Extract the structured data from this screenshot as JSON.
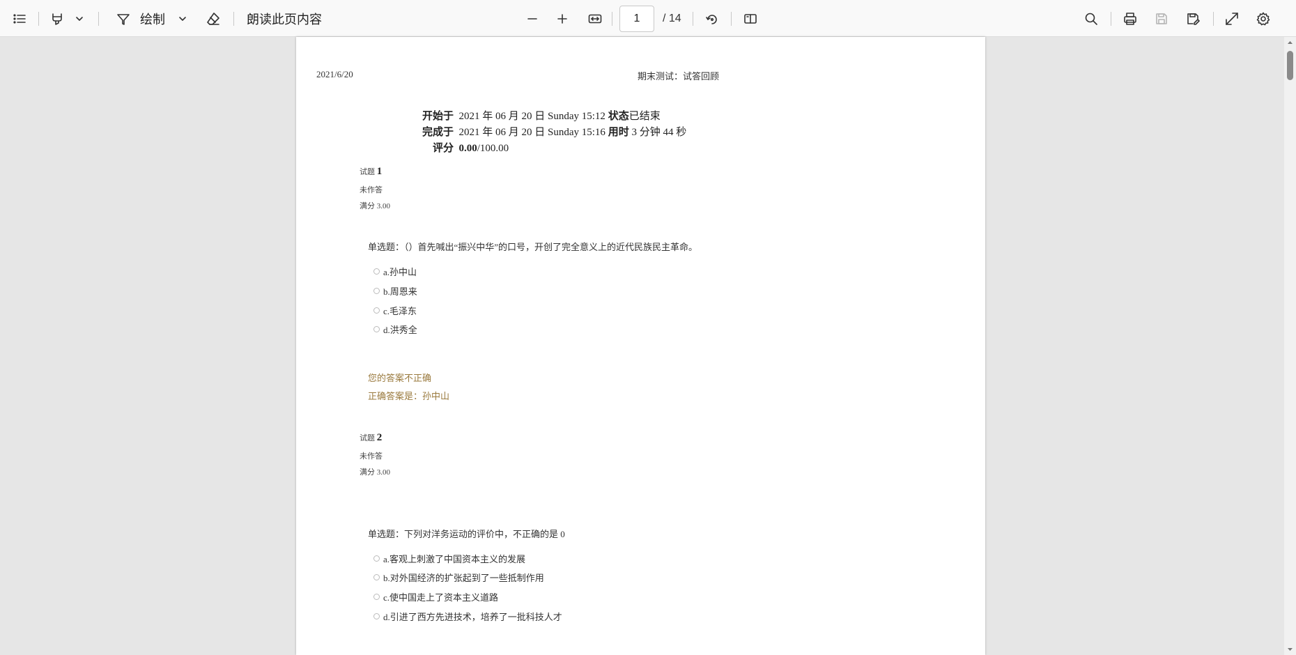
{
  "toolbar": {
    "draw_label": "绘制",
    "read_aloud_label": "朗读此页内容",
    "page_current": "1",
    "page_total": "/ 14"
  },
  "document": {
    "header_date": "2021/6/20",
    "header_title": "期末测试：试答回顾",
    "summary": {
      "started_label": "开始于",
      "started_value": "2021 年 06 月 20 日 Sunday 15:12",
      "state_label": "状态",
      "state_value": "已结束",
      "completed_label": "完成于",
      "completed_value": "2021 年 06 月 20 日 Sunday 15:16",
      "time_label": "用时",
      "time_value": "3 分钟 44 秒",
      "grade_label": "评分",
      "grade_score": "0.00",
      "grade_max": "/100.00"
    },
    "questions": [
      {
        "label": "试题",
        "number": "1",
        "status": "未作答",
        "marks": "满分 3.00",
        "text": "单选题：（）首先喊出“振兴中华”的口号，开创了完全意义上的近代民族民主革命。",
        "options": [
          "a.孙中山",
          "b.周恩来",
          "c.毛泽东",
          "d.洪秀全"
        ],
        "feedback": "您的答案不正确",
        "correct": "正确答案是：孙中山"
      },
      {
        "label": "试题",
        "number": "2",
        "status": "未作答",
        "marks": "满分 3.00",
        "text": "单选题：下列对洋务运动的评价中，不正确的是 0",
        "options": [
          "a.客观上刺激了中国资本主义的发展",
          "b.对外国经济的扩张起到了一些抵制作用",
          "c.使中国走上了资本主义道路",
          "d.引进了西方先进技术，培养了一批科技人才"
        ]
      }
    ]
  }
}
